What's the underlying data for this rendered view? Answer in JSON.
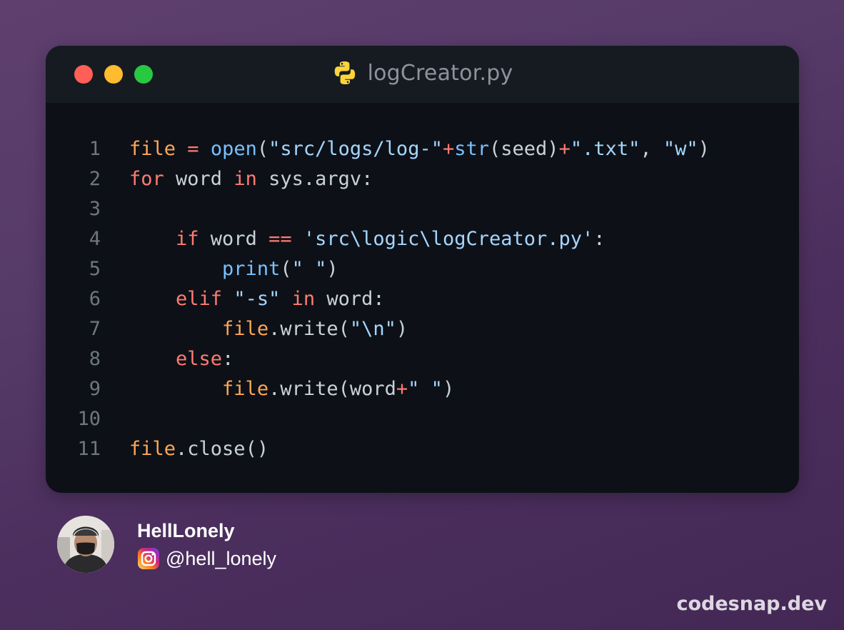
{
  "window": {
    "file_name": "logCreator.py",
    "file_icon": "python-icon",
    "controls": [
      "close",
      "minimize",
      "maximize"
    ]
  },
  "colors": {
    "background": "#553a68",
    "editor_bg": "#0d1117",
    "titlebar_bg": "#161b22",
    "close": "#ff5f57",
    "minimize": "#febc2e",
    "maximize": "#28c840",
    "variable": "#ffa657",
    "keyword": "#ff7b72",
    "function": "#79c0ff",
    "string": "#a5d6ff",
    "default_text": "#c9d1d9",
    "line_number": "#6e7681"
  },
  "code": {
    "language": "python",
    "lines": [
      {
        "number": "1",
        "tokens": [
          {
            "t": "file",
            "c": "var"
          },
          {
            "t": " ",
            "c": "def"
          },
          {
            "t": "=",
            "c": "op"
          },
          {
            "t": " ",
            "c": "def"
          },
          {
            "t": "open",
            "c": "fn"
          },
          {
            "t": "(",
            "c": "def"
          },
          {
            "t": "\"src/logs/log-\"",
            "c": "str"
          },
          {
            "t": "+",
            "c": "op"
          },
          {
            "t": "str",
            "c": "fn"
          },
          {
            "t": "(seed)",
            "c": "def"
          },
          {
            "t": "+",
            "c": "op"
          },
          {
            "t": "\".txt\"",
            "c": "str"
          },
          {
            "t": ", ",
            "c": "def"
          },
          {
            "t": "\"w\"",
            "c": "str"
          },
          {
            "t": ")",
            "c": "def"
          }
        ]
      },
      {
        "number": "2",
        "tokens": [
          {
            "t": "for",
            "c": "kw"
          },
          {
            "t": " word ",
            "c": "def"
          },
          {
            "t": "in",
            "c": "kw"
          },
          {
            "t": " sys.argv:",
            "c": "def"
          }
        ]
      },
      {
        "number": "3",
        "tokens": []
      },
      {
        "number": "4",
        "tokens": [
          {
            "t": "    ",
            "c": "def"
          },
          {
            "t": "if",
            "c": "kw"
          },
          {
            "t": " word ",
            "c": "def"
          },
          {
            "t": "==",
            "c": "op"
          },
          {
            "t": " ",
            "c": "def"
          },
          {
            "t": "'src\\logic\\logCreator.py'",
            "c": "str"
          },
          {
            "t": ":",
            "c": "def"
          }
        ]
      },
      {
        "number": "5",
        "tokens": [
          {
            "t": "        ",
            "c": "def"
          },
          {
            "t": "print",
            "c": "fn"
          },
          {
            "t": "(",
            "c": "def"
          },
          {
            "t": "\" \"",
            "c": "str"
          },
          {
            "t": ")",
            "c": "def"
          }
        ]
      },
      {
        "number": "6",
        "tokens": [
          {
            "t": "    ",
            "c": "def"
          },
          {
            "t": "elif",
            "c": "kw"
          },
          {
            "t": " ",
            "c": "def"
          },
          {
            "t": "\"-s\"",
            "c": "str"
          },
          {
            "t": " ",
            "c": "def"
          },
          {
            "t": "in",
            "c": "kw"
          },
          {
            "t": " word:",
            "c": "def"
          }
        ]
      },
      {
        "number": "7",
        "tokens": [
          {
            "t": "        ",
            "c": "def"
          },
          {
            "t": "file",
            "c": "var"
          },
          {
            "t": ".write(",
            "c": "def"
          },
          {
            "t": "\"\\n\"",
            "c": "str"
          },
          {
            "t": ")",
            "c": "def"
          }
        ]
      },
      {
        "number": "8",
        "tokens": [
          {
            "t": "    ",
            "c": "def"
          },
          {
            "t": "else",
            "c": "kw"
          },
          {
            "t": ":",
            "c": "def"
          }
        ]
      },
      {
        "number": "9",
        "tokens": [
          {
            "t": "        ",
            "c": "def"
          },
          {
            "t": "file",
            "c": "var"
          },
          {
            "t": ".write(word",
            "c": "def"
          },
          {
            "t": "+",
            "c": "op"
          },
          {
            "t": "\" \"",
            "c": "str"
          },
          {
            "t": ")",
            "c": "def"
          }
        ]
      },
      {
        "number": "10",
        "tokens": []
      },
      {
        "number": "11",
        "tokens": [
          {
            "t": "file",
            "c": "var"
          },
          {
            "t": ".close()",
            "c": "def"
          }
        ]
      }
    ]
  },
  "author": {
    "name": "HellLonely",
    "platform_icon": "instagram-icon",
    "handle": "@hell_lonely",
    "avatar": "avatar"
  },
  "watermark": "codesnap.dev"
}
